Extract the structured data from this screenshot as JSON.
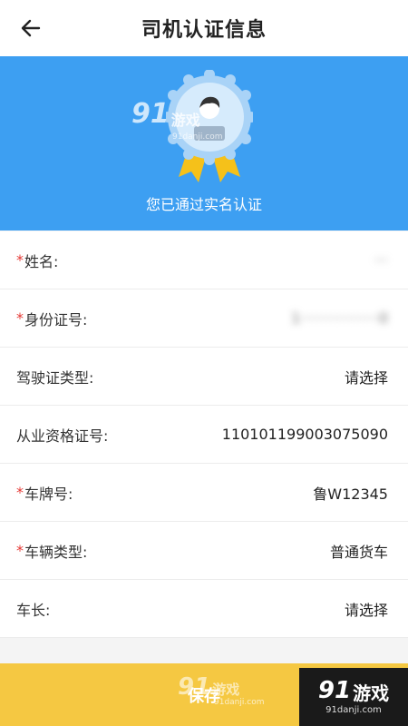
{
  "header": {
    "title": "司机认证信息"
  },
  "banner": {
    "status_text": "您已通过实名认证",
    "watermark_brand": "91",
    "watermark_text": "游戏",
    "watermark_url": "91danji.com"
  },
  "form": {
    "rows": [
      {
        "label": "姓名:",
        "required": true,
        "value": "···",
        "blurred": true
      },
      {
        "label": "身份证号:",
        "required": true,
        "value": "1·················0",
        "blurred": true
      },
      {
        "label": "驾驶证类型:",
        "required": false,
        "value": "请选择",
        "blurred": false
      },
      {
        "label": "从业资格证号:",
        "required": false,
        "value": "110101199003075090",
        "blurred": false
      },
      {
        "label": "车牌号:",
        "required": true,
        "value": "鲁W12345",
        "blurred": false
      },
      {
        "label": "车辆类型:",
        "required": true,
        "value": "普通货车",
        "blurred": false
      },
      {
        "label": "车长:",
        "required": false,
        "value": "请选择",
        "blurred": false
      }
    ]
  },
  "footer": {
    "save_label": "保存",
    "watermark_brand": "91",
    "watermark_text": "游戏",
    "watermark_url": "91danji.com"
  },
  "logo": {
    "brand": "91",
    "text": "游戏",
    "url": "91danji.com"
  },
  "colors": {
    "banner": "#3d9ff2",
    "save_bar": "#f5c842",
    "required": "#e53935"
  }
}
